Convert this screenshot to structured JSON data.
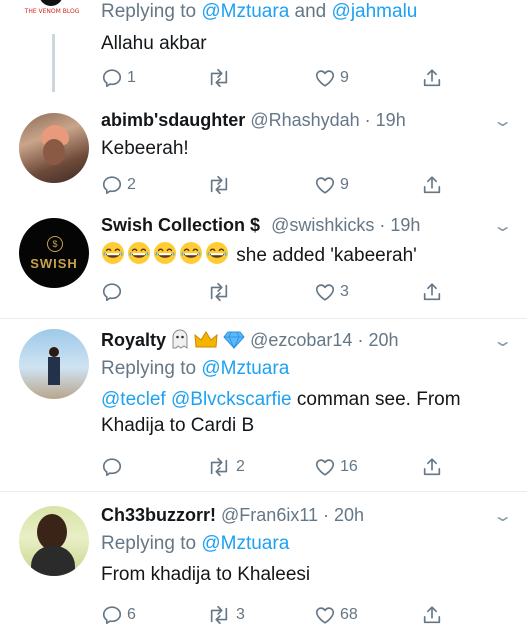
{
  "tweets": [
    {
      "avatar_text": "THE VENOM BLOG",
      "reply_prefix": "Replying to ",
      "reply_user1": "@Mztuara",
      "reply_and": " and ",
      "reply_user2": "@jahmalu",
      "text": "Allahu akbar",
      "replies": "1",
      "retweets": "",
      "likes": "9"
    },
    {
      "name": "abimb'sdaughter",
      "handle": "@Rhashydah",
      "dot": " · ",
      "time": "19h",
      "text": "Kebeerah!",
      "replies": "2",
      "retweets": "",
      "likes": "9"
    },
    {
      "name": "Swish Collection",
      "name_symbol": "$",
      "handle": "@swishkicks",
      "dot": " · ",
      "time": "19h",
      "avatar_text": "SWISH",
      "text": " she added 'kabeerah'",
      "replies": "",
      "retweets": "",
      "likes": "3"
    },
    {
      "name": "Royalty",
      "handle": "@ezcobar14",
      "dot": " · ",
      "time": "20h",
      "reply_prefix": "Replying to ",
      "reply_user1": "@Mztuara",
      "mention1": "@teclef",
      "mention2": "@Blvckscarfie",
      "text1": " comman see. From",
      "text2": "Khadija to Cardi B",
      "replies": "",
      "retweets": "2",
      "likes": "16"
    },
    {
      "name": "Ch33buzzorr!",
      "handle": "@Fran6ix11",
      "dot": " · ",
      "time": "20h",
      "reply_prefix": "Replying to ",
      "reply_user1": "@Mztuara",
      "text": "From khadija to Khaleesi",
      "replies": "6",
      "retweets": "3",
      "likes": "68"
    }
  ],
  "chevron": "⌄",
  "colors": {
    "link": "#1da1f2",
    "muted": "#657786",
    "divider": "#e6ecf0"
  }
}
